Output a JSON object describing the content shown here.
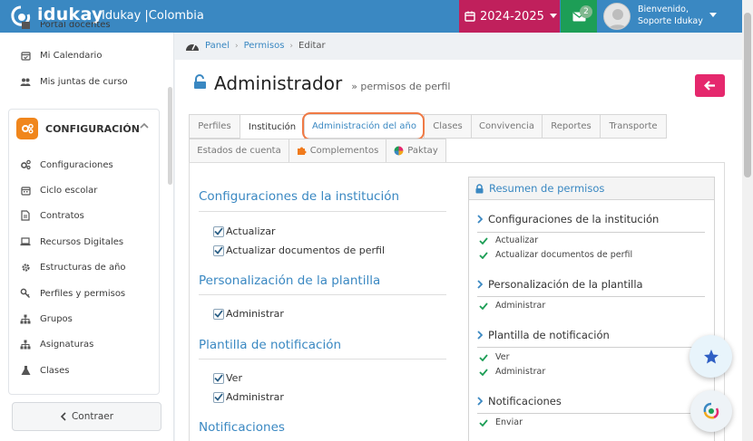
{
  "header": {
    "logo_text": "idukay",
    "logo_separator": ":",
    "company": "Idukay |Colombia",
    "year": "2024-2025",
    "message_count": "2",
    "user_greeting": "Bienvenido,",
    "user_name": "Soporte Idukay"
  },
  "sidebar": {
    "top_partial_item": "Portal docentes",
    "top_items": [
      {
        "label": "Mi Calendario",
        "icon": "calendar-check-icon"
      },
      {
        "label": "Mis juntas de curso",
        "icon": "users-icon"
      }
    ],
    "section_title": "CONFIGURACIÓN",
    "items": [
      {
        "label": "Configuraciones",
        "icon": "cogs-icon"
      },
      {
        "label": "Ciclo escolar",
        "icon": "calendar-icon"
      },
      {
        "label": "Contratos",
        "icon": "file-icon"
      },
      {
        "label": "Recursos Digitales",
        "icon": "laptop-icon"
      },
      {
        "label": "Estructuras de año",
        "icon": "cog-icon"
      },
      {
        "label": "Perfiles y permisos",
        "icon": "key-icon"
      },
      {
        "label": "Grupos",
        "icon": "sitemap-icon"
      },
      {
        "label": "Asignaturas",
        "icon": "sitemap-icon"
      },
      {
        "label": "Clases",
        "icon": "flask-icon"
      }
    ],
    "collapse_label": "Contraer"
  },
  "breadcrumb": {
    "items": [
      "Panel",
      "Permisos"
    ],
    "current": "Editar"
  },
  "page": {
    "title": "Administrador",
    "subtitle": "» permisos de perfil"
  },
  "tabs": {
    "row1": [
      "Perfiles",
      "Institución",
      "Administración del año",
      "Clases",
      "Convivencia",
      "Reportes",
      "Transporte"
    ],
    "row2": [
      "Estados de cuenta",
      "Complementos",
      "Paktay"
    ],
    "active": "Institución",
    "highlighted": "Administración del año"
  },
  "permissions": {
    "sections": [
      {
        "title": "Configuraciones de la institución",
        "items": [
          "Actualizar",
          "Actualizar documentos de perfil"
        ]
      },
      {
        "title": "Personalización de la plantilla",
        "items": [
          "Administrar"
        ]
      },
      {
        "title": "Plantilla de notificación",
        "items": [
          "Ver",
          "Administrar"
        ]
      },
      {
        "title": "Notificaciones",
        "items": []
      }
    ]
  },
  "summary": {
    "title": "Resumen de permisos",
    "sections": [
      {
        "title": "Configuraciones de la institución",
        "items": [
          "Actualizar",
          "Actualizar documentos de perfil"
        ]
      },
      {
        "title": "Personalización de la plantilla",
        "items": [
          "Administrar"
        ]
      },
      {
        "title": "Plantilla de notificación",
        "items": [
          "Ver",
          "Administrar"
        ]
      },
      {
        "title": "Notificaciones",
        "items": [
          "Enviar"
        ]
      }
    ]
  },
  "colors": {
    "topbar": "#3a88c2",
    "year_selector": "#c0205c",
    "messages": "#1d9e56",
    "accent_link": "#3a88c2",
    "back_button": "#e5286d",
    "highlight_ring": "#f07a45"
  }
}
